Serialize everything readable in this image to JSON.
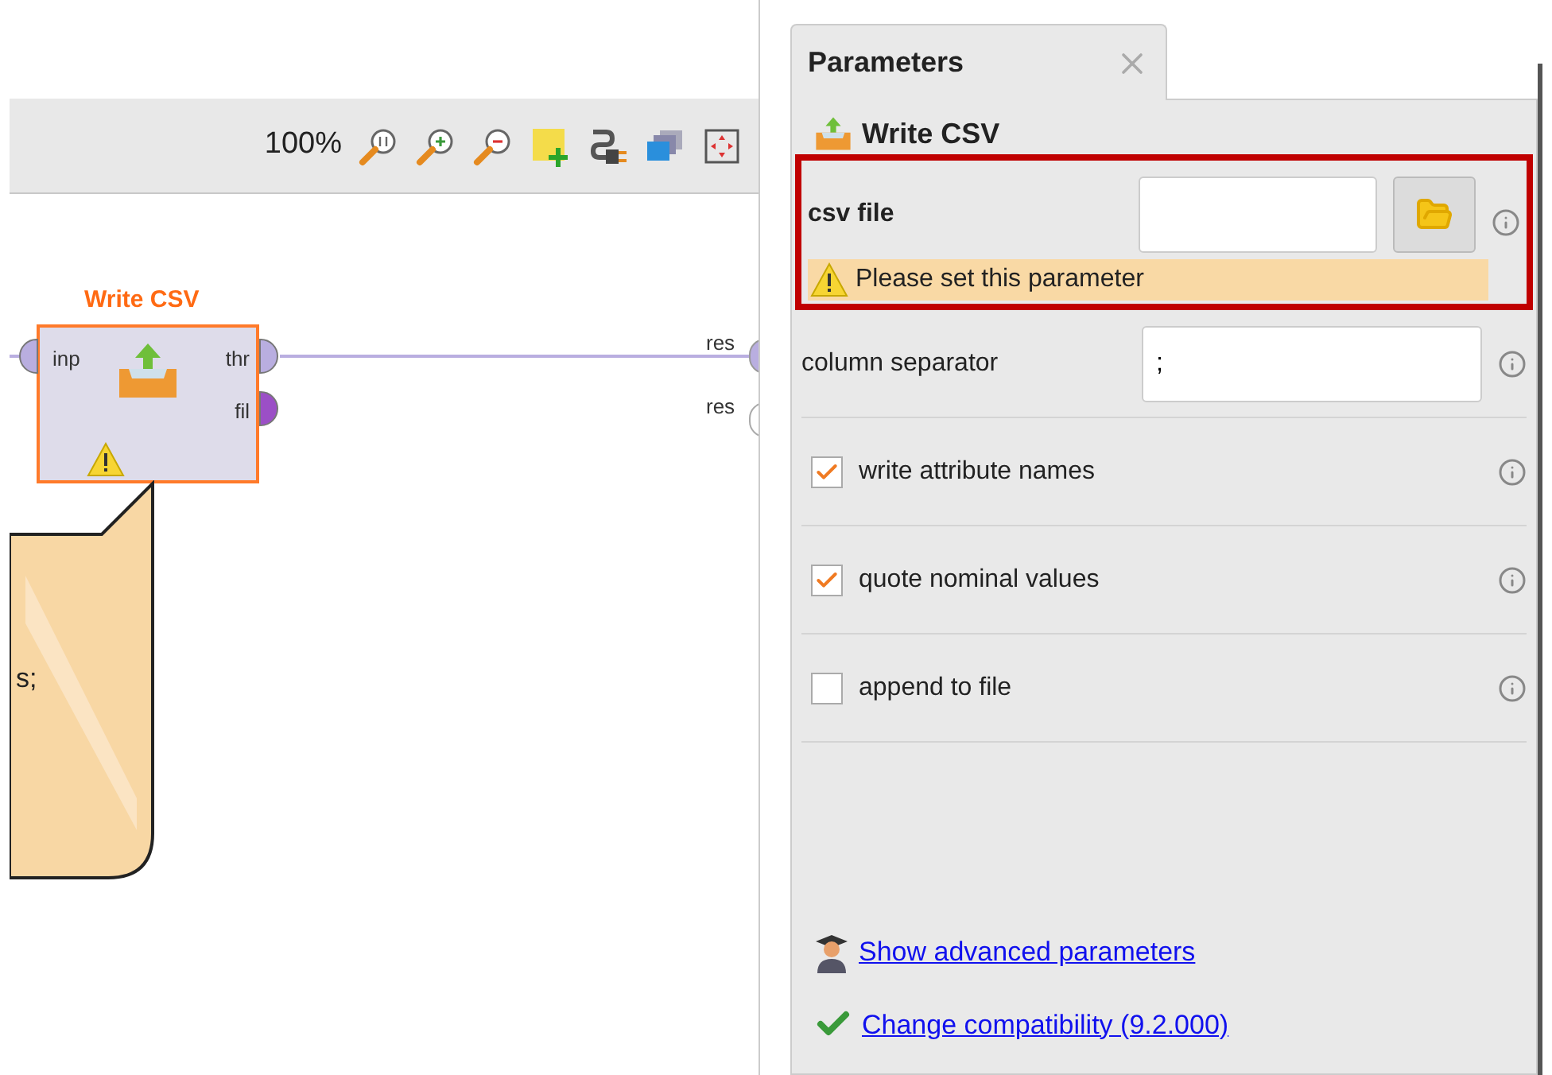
{
  "canvas": {
    "zoom": "100%",
    "operator": {
      "title": "Write CSV",
      "warning": true,
      "inputs": [
        {
          "label": "inp",
          "color": "#b9aee0"
        }
      ],
      "outputs": [
        {
          "label": "thr",
          "color": "#b9aee0"
        },
        {
          "label": "fil",
          "color": "#9b4fc6"
        }
      ]
    },
    "result_ports": [
      {
        "label": "res",
        "connected": true
      },
      {
        "label": "res",
        "connected": false
      }
    ],
    "note": {
      "text": "s;"
    }
  },
  "parameters": {
    "tab": {
      "label": "Parameters",
      "selected": true
    },
    "operator": "Write CSV",
    "items": [
      {
        "kind": "file",
        "label": "csv file",
        "required": true,
        "error": "Please set this parameter"
      },
      {
        "kind": "text",
        "label": "column separator",
        "value": ";"
      },
      {
        "kind": "checkbox",
        "label": "write attribute names",
        "checked": true
      },
      {
        "kind": "checkbox",
        "label": "quote nominal values",
        "checked": true
      },
      {
        "kind": "checkbox",
        "label": "append to file",
        "checked": false
      }
    ],
    "links": [
      {
        "kind": "advanced",
        "text": "Show advanced parameters"
      },
      {
        "kind": "compatibility",
        "text": "Change compatibility (9.2.000)"
      }
    ]
  }
}
